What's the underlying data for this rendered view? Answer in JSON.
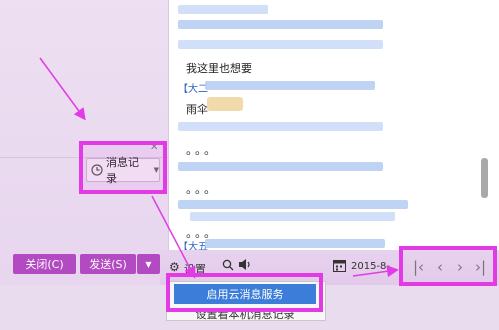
{
  "history_button": {
    "label": "消息记录"
  },
  "buttons": {
    "close": "关闭(C)",
    "send": "发送(S)"
  },
  "messages": {
    "msg1": "我这里也想要",
    "sender1": "【大二",
    "msg2": "雨伞",
    "dots1": "。。。",
    "dots2": "。。。",
    "dots3": "。。。",
    "sender2": "【大五"
  },
  "toolbar": {
    "label": "设置",
    "date": "2015-8-"
  },
  "popup": {
    "item1": "启用云消息服务",
    "item2": "设置看本机消息记录"
  },
  "icons": {
    "clock": "clock-icon",
    "send_menu": "caret-down-icon",
    "settings": "gear-icon",
    "search": "search-icon",
    "volume": "speaker-icon",
    "calendar": "calendar-icon",
    "first": "first-page-icon",
    "prev": "prev-page-icon",
    "next": "next-page-icon",
    "last": "last-page-icon"
  },
  "colors": {
    "highlight": "#e23be6",
    "button_bg": "#b24bc1",
    "popup_selected": "#3b7dd8"
  }
}
